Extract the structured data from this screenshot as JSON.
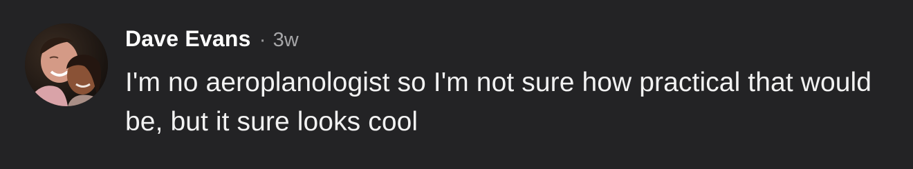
{
  "comment": {
    "author": "Dave Evans",
    "separator": "·",
    "timestamp": "3w",
    "text": "I'm no aeroplanologist so I'm not sure how practical that would be, but it sure looks cool",
    "avatar_icon": "user-photo-avatar"
  },
  "colors": {
    "background": "#232325",
    "author": "#ffffff",
    "timestamp": "#a6a6a8",
    "body": "#f2f2f2"
  }
}
